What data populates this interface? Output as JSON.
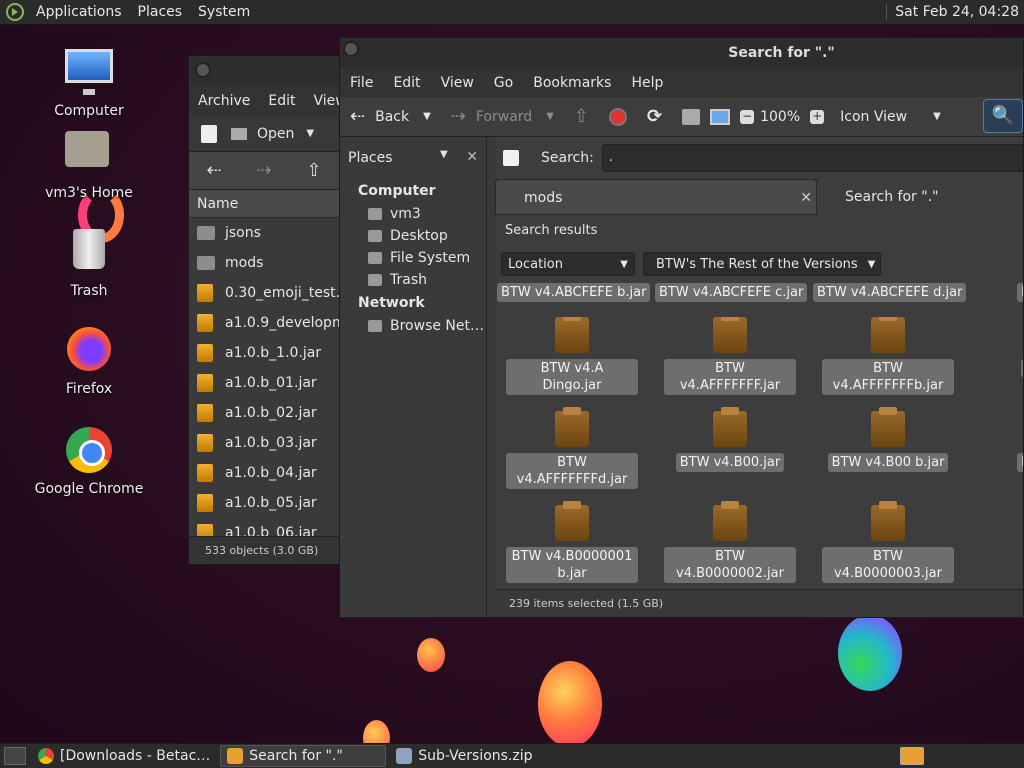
{
  "top_panel": {
    "menus": [
      "Applications",
      "Places",
      "System"
    ],
    "clock": "Sat Feb 24, 04:28"
  },
  "desktop": {
    "icons": [
      {
        "label": "Computer",
        "icon": "computer-icon"
      },
      {
        "label": "vm3's Home",
        "icon": "home-folder-icon"
      },
      {
        "label": "Trash",
        "icon": "trash-icon"
      },
      {
        "label": "Firefox",
        "icon": "firefox-icon"
      },
      {
        "label": "Google Chrome",
        "icon": "chrome-icon"
      }
    ]
  },
  "archive_window": {
    "menus": [
      "Archive",
      "Edit",
      "View"
    ],
    "open_label": "Open",
    "column_name": "Name",
    "rows": [
      {
        "name": "jsons",
        "kind": "folder"
      },
      {
        "name": "mods",
        "kind": "folder"
      },
      {
        "name": "0.30_emoji_test.jar",
        "kind": "jar"
      },
      {
        "name": "a1.0.9_developmen",
        "kind": "jar"
      },
      {
        "name": "a1.0.b_1.0.jar",
        "kind": "jar"
      },
      {
        "name": "a1.0.b_01.jar",
        "kind": "jar"
      },
      {
        "name": "a1.0.b_02.jar",
        "kind": "jar"
      },
      {
        "name": "a1.0.b_03.jar",
        "kind": "jar"
      },
      {
        "name": "a1.0.b_04.jar",
        "kind": "jar"
      },
      {
        "name": "a1.0.b_05.jar",
        "kind": "jar"
      },
      {
        "name": "a1.0.b_06.jar",
        "kind": "jar"
      }
    ],
    "status": "533 objects (3.0 GB)"
  },
  "search_window": {
    "title": "Search for \".\"",
    "menus": [
      "File",
      "Edit",
      "View",
      "Go",
      "Bookmarks",
      "Help"
    ],
    "toolbar": {
      "back": "Back",
      "forward": "Forward",
      "zoom": "100%",
      "view_mode": "Icon View"
    },
    "sidebar": {
      "header": "Places",
      "groups": [
        {
          "title": "Computer",
          "items": [
            "vm3",
            "Desktop",
            "File System",
            "Trash"
          ]
        },
        {
          "title": "Network",
          "items": [
            "Browse Net…"
          ]
        }
      ]
    },
    "search": {
      "label": "Search:",
      "value": "."
    },
    "tabs": [
      {
        "label": "mods"
      },
      {
        "label": "Search for \".\""
      }
    ],
    "results_title": "Search results",
    "filters": {
      "location_label": "Location",
      "folder_label": "BTW's The Rest of the Versions"
    },
    "top_row_files": [
      "BTW v4.ABCFEFE b.jar",
      "BTW v4.ABCFEFE c.jar",
      "BTW v4.ABCFEFE d.jar",
      "BTW v4"
    ],
    "file_rows": [
      [
        "BTW v4.A Dingo.jar",
        "BTW v4.AFFFFFFF.jar",
        "BTW v4.AFFFFFFFb.jar",
        "BTW v"
      ],
      [
        "BTW v4.AFFFFFFFd.jar",
        "BTW v4.B00.jar",
        "BTW v4.B00 b.jar",
        "BTW v4"
      ],
      [
        "BTW v4.B0000001 b.jar",
        "BTW v4.B0000002.jar",
        "BTW v4.B0000003.jar"
      ]
    ],
    "status": "239 items selected (1.5 GB)"
  },
  "taskbar": {
    "tasks": [
      {
        "label": "[Downloads - Betac…",
        "active": false
      },
      {
        "label": "Search for \".\"",
        "active": true
      },
      {
        "label": "Sub-Versions.zip",
        "active": false
      }
    ]
  }
}
